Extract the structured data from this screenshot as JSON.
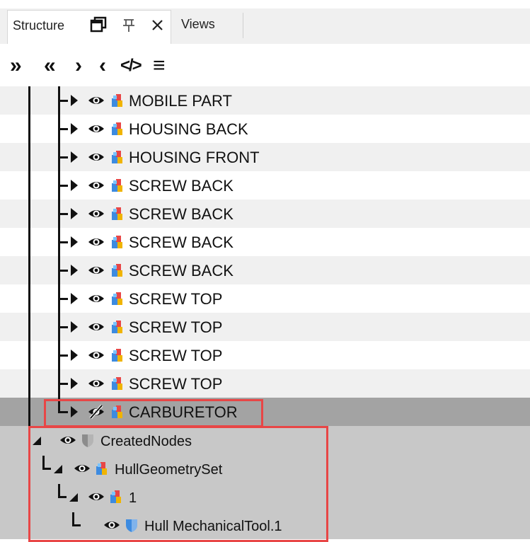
{
  "tabs": {
    "active": "Structure",
    "other": "Views"
  },
  "toolbar": {
    "buttons": [
      {
        "name": "expand-all",
        "glyph": "»"
      },
      {
        "name": "collapse-all",
        "glyph": "«"
      },
      {
        "name": "expand",
        "glyph": "›"
      },
      {
        "name": "collapse",
        "glyph": "‹"
      },
      {
        "name": "code-view",
        "glyph": "</>"
      },
      {
        "name": "menu",
        "glyph": "≡"
      }
    ]
  },
  "tree": {
    "rows": [
      {
        "label": "MOBILE PART",
        "visible": true,
        "icon": "part-multicolor-icon",
        "expander": "collapsed"
      },
      {
        "label": "HOUSING BACK",
        "visible": true,
        "icon": "part-multicolor-icon",
        "expander": "collapsed"
      },
      {
        "label": "HOUSING FRONT",
        "visible": true,
        "icon": "part-multicolor-icon",
        "expander": "collapsed"
      },
      {
        "label": "SCREW BACK",
        "visible": true,
        "icon": "part-multicolor-icon",
        "expander": "collapsed"
      },
      {
        "label": "SCREW BACK",
        "visible": true,
        "icon": "part-multicolor-icon",
        "expander": "collapsed"
      },
      {
        "label": "SCREW BACK",
        "visible": true,
        "icon": "part-multicolor-icon",
        "expander": "collapsed"
      },
      {
        "label": "SCREW BACK",
        "visible": true,
        "icon": "part-multicolor-icon",
        "expander": "collapsed"
      },
      {
        "label": "SCREW TOP",
        "visible": true,
        "icon": "part-multicolor-icon",
        "expander": "collapsed"
      },
      {
        "label": "SCREW TOP",
        "visible": true,
        "icon": "part-multicolor-icon",
        "expander": "collapsed"
      },
      {
        "label": "SCREW TOP",
        "visible": true,
        "icon": "part-multicolor-icon",
        "expander": "collapsed"
      },
      {
        "label": "SCREW TOP",
        "visible": true,
        "icon": "part-multicolor-icon",
        "expander": "collapsed"
      },
      {
        "label": "CARBURETOR",
        "visible": false,
        "icon": "part-multicolor-icon",
        "expander": "collapsed"
      },
      {
        "label": "CreatedNodes",
        "visible": true,
        "icon": "shield-gray-icon",
        "expander": "expanded"
      },
      {
        "label": "HullGeometrySet",
        "visible": true,
        "icon": "part-multicolor-icon",
        "expander": "expanded"
      },
      {
        "label": "1",
        "visible": true,
        "icon": "part-multicolor-icon",
        "expander": "expanded"
      },
      {
        "label": "Hull MechanicalTool.1",
        "visible": true,
        "icon": "shield-blue-icon",
        "expander": "none"
      }
    ]
  },
  "colors": {
    "row_light": "#ffffff",
    "row_alt": "#f0f0f0",
    "row_selected": "#a3a3a3",
    "row_created": "#c8c8c8",
    "highlight": "#e84646"
  }
}
